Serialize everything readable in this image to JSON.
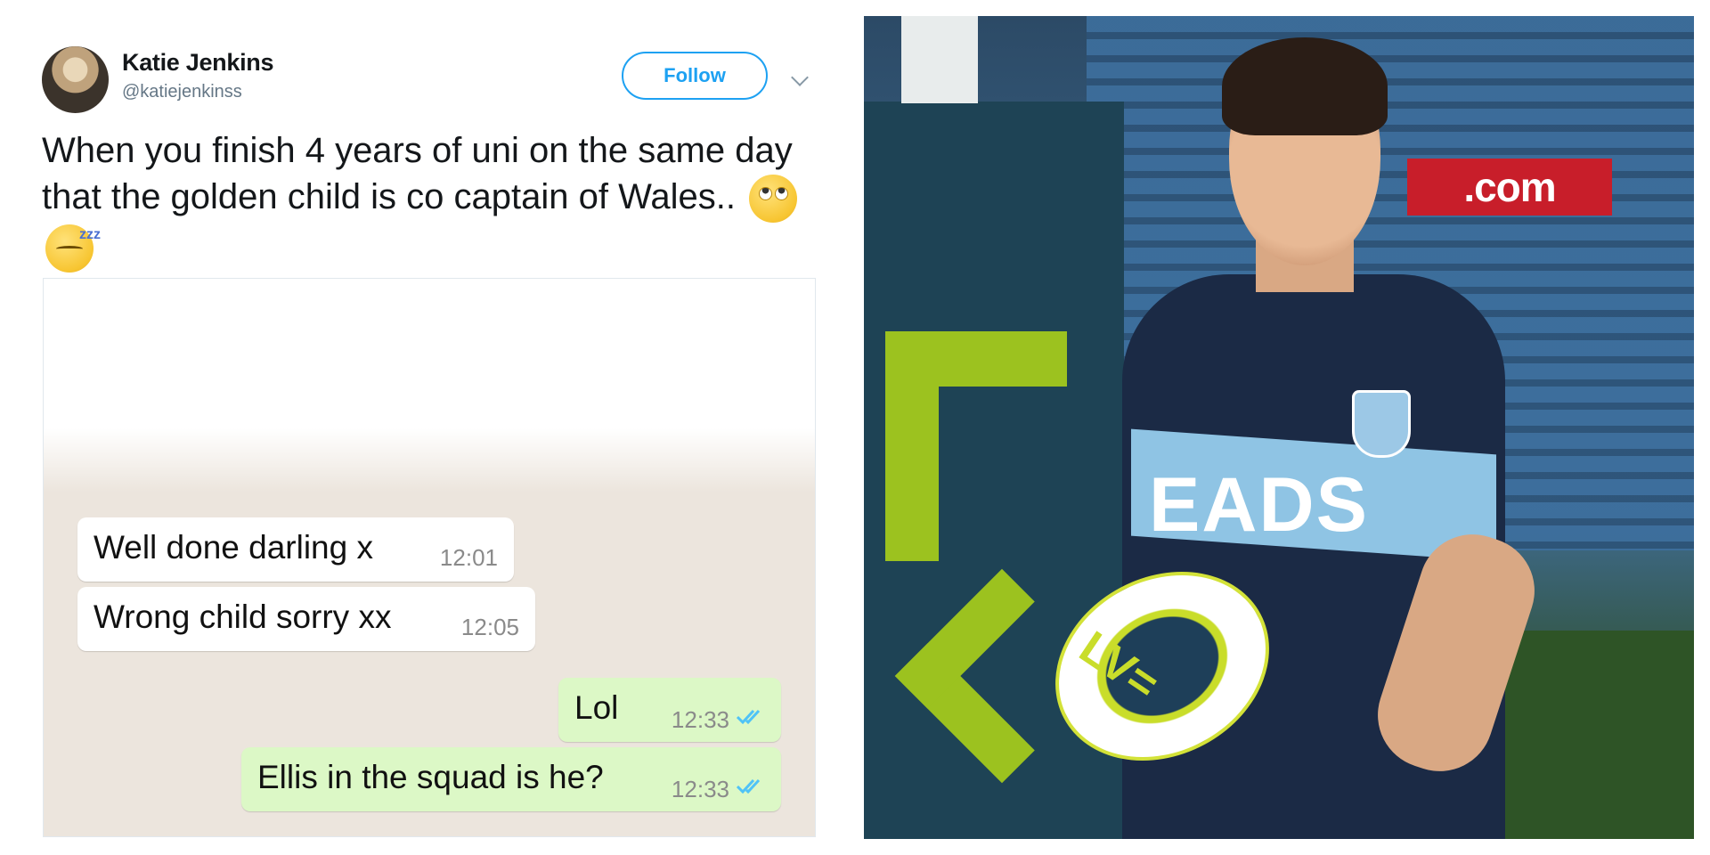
{
  "tweet": {
    "author_name": "Katie Jenkins",
    "author_handle": "@katiejenkinss",
    "follow_label": "Follow",
    "text": "When you finish 4 years of uni on the same day that the golden child is co captain of Wales..",
    "emojis": [
      "face-with-rolling-eyes",
      "sleeping-face"
    ]
  },
  "chat": {
    "messages": [
      {
        "direction": "incoming",
        "text": "Well done darling x",
        "time": "12:01"
      },
      {
        "direction": "incoming",
        "text": "Wrong child sorry xx",
        "time": "12:05"
      },
      {
        "direction": "outgoing",
        "text": "Lol",
        "time": "12:33",
        "status": "read"
      },
      {
        "direction": "outgoing",
        "text": "Ellis in the squad is he?",
        "time": "12:33",
        "status": "read"
      }
    ],
    "colors": {
      "incoming": "#ffffff",
      "outgoing": "#dcf8c6",
      "background": "#ece5dd",
      "read_ticks": "#4fc3f7"
    }
  },
  "photo": {
    "subject": "rugby-player-with-ball",
    "shirt_sponsor": "EADS",
    "board_text": ".com",
    "ball_logo": "LV=",
    "colors": {
      "shirt": "#1b2a45",
      "stripe": "#8fc4e4",
      "accent_green": "#9cc21f"
    }
  }
}
